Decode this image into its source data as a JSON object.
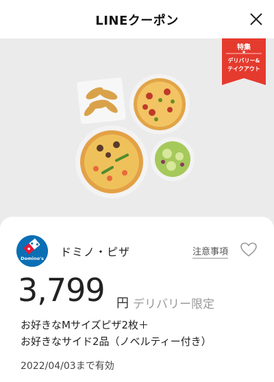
{
  "header": {
    "title": "LINEクーポン",
    "close_icon": "close-icon"
  },
  "hero": {
    "badge": {
      "head": "特集",
      "star": "★",
      "line1": "デリバリー&",
      "line2": "テイクアウト",
      "color": "#e53a2e"
    },
    "image_description_icon": "pizza-photo"
  },
  "coupon": {
    "brand_name": "ドミノ・ピザ",
    "brand_logo_text": "Domino's",
    "notes_label": "注意事項",
    "favorite_icon": "heart-icon",
    "price": "3,799",
    "price_unit": "円",
    "price_condition": "デリバリー限定",
    "description_line1": "お好きなMサイズピザ2枚＋",
    "description_line2": "お好きなサイド2品（ノベルティー付き）",
    "expiry": "2022/04/03まで有効"
  },
  "colors": {
    "accent_red": "#e53a2e",
    "domino_blue": "#0a6fb5",
    "hero_bg": "#ebebeb"
  }
}
